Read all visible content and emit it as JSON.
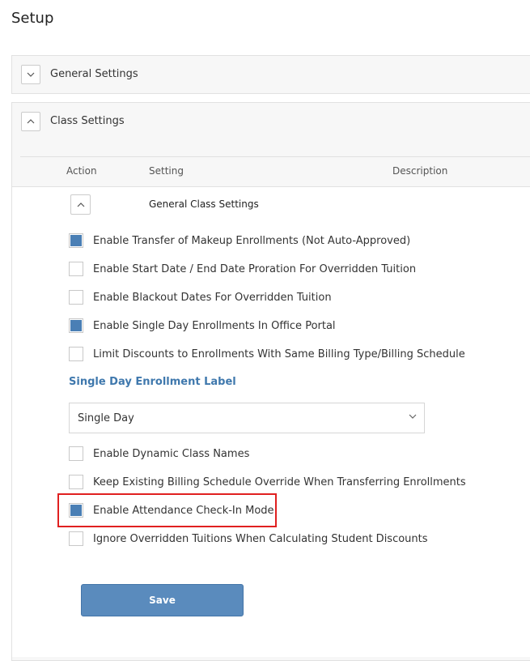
{
  "page": {
    "title": "Setup"
  },
  "panels": {
    "general": {
      "label": "General Settings",
      "expanded": false
    },
    "class": {
      "label": "Class Settings",
      "expanded": true
    }
  },
  "table": {
    "columns": [
      "Action",
      "Setting",
      "Description"
    ],
    "group_label": "General Class Settings"
  },
  "settings": [
    {
      "label": "Enable Transfer of Makeup Enrollments (Not Auto-Approved)",
      "checked": true
    },
    {
      "label": "Enable Start Date / End Date Proration For Overridden Tuition",
      "checked": false
    },
    {
      "label": "Enable Blackout Dates For Overridden Tuition",
      "checked": false
    },
    {
      "label": "Enable Single Day Enrollments In Office Portal",
      "checked": true
    },
    {
      "label": "Limit Discounts to Enrollments With Same Billing Type/Billing Schedule",
      "checked": false
    },
    {
      "label": "Enable Dynamic Class Names",
      "checked": false
    },
    {
      "label": "Keep Existing Billing Schedule Override When Transferring Enrollments",
      "checked": false
    },
    {
      "label": "Enable Attendance Check-In Mode",
      "checked": true
    },
    {
      "label": "Ignore Overridden Tuitions When Calculating Student Discounts",
      "checked": false
    }
  ],
  "single_day_label": {
    "heading": "Single Day Enrollment Label",
    "selected_value": "Single Day"
  },
  "save_label": "Save",
  "colors": {
    "accent": "#4a7fb5",
    "link_blue": "#3f78ad",
    "highlight_red": "#e02020",
    "button_blue": "#5a8bbd"
  }
}
